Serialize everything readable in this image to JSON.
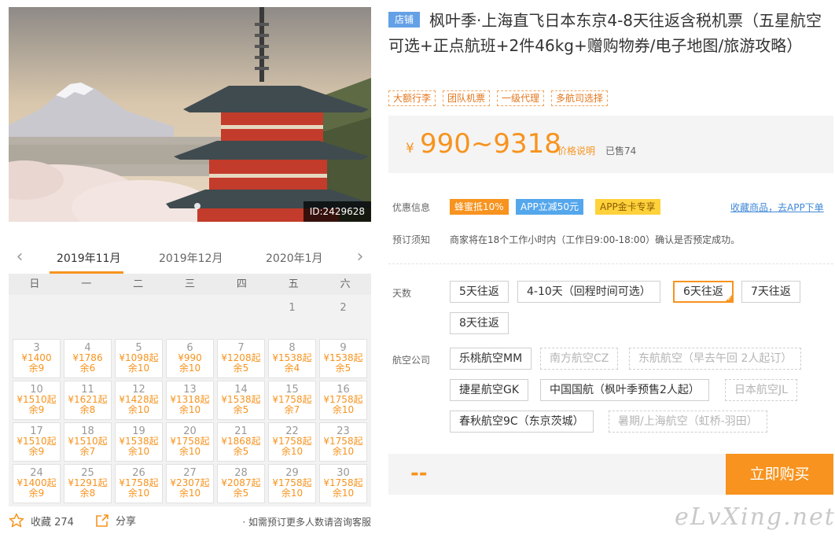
{
  "hero": {
    "id_label": "ID:2429628"
  },
  "calendar": {
    "months": [
      "2019年11月",
      "2019年12月",
      "2020年1月"
    ],
    "weekdays": [
      "日",
      "一",
      "二",
      "三",
      "四",
      "五",
      "六"
    ],
    "empty_days": [
      "1",
      "2"
    ],
    "days": [
      {
        "d": "3",
        "p": "¥1400",
        "r": "余9"
      },
      {
        "d": "4",
        "p": "¥1786",
        "r": "余6"
      },
      {
        "d": "5",
        "p": "¥1098起",
        "r": "余10"
      },
      {
        "d": "6",
        "p": "¥990",
        "r": "余10"
      },
      {
        "d": "7",
        "p": "¥1208起",
        "r": "余5"
      },
      {
        "d": "8",
        "p": "¥1538起",
        "r": "余4"
      },
      {
        "d": "9",
        "p": "¥1538起",
        "r": "余5"
      },
      {
        "d": "10",
        "p": "¥1510起",
        "r": "余9"
      },
      {
        "d": "11",
        "p": "¥1621起",
        "r": "余8"
      },
      {
        "d": "12",
        "p": "¥1428起",
        "r": "余10"
      },
      {
        "d": "13",
        "p": "¥1318起",
        "r": "余10"
      },
      {
        "d": "14",
        "p": "¥1538起",
        "r": "余5"
      },
      {
        "d": "15",
        "p": "¥1758起",
        "r": "余7"
      },
      {
        "d": "16",
        "p": "¥1758起",
        "r": "余10"
      },
      {
        "d": "17",
        "p": "¥1510起",
        "r": "余9"
      },
      {
        "d": "18",
        "p": "¥1510起",
        "r": "余7"
      },
      {
        "d": "19",
        "p": "¥1538起",
        "r": "余10"
      },
      {
        "d": "20",
        "p": "¥1758起",
        "r": "余10"
      },
      {
        "d": "21",
        "p": "¥1868起",
        "r": "余5"
      },
      {
        "d": "22",
        "p": "¥1758起",
        "r": "余10"
      },
      {
        "d": "23",
        "p": "¥1758起",
        "r": "余10"
      },
      {
        "d": "24",
        "p": "¥1400起",
        "r": "余9"
      },
      {
        "d": "25",
        "p": "¥1291起",
        "r": "余8"
      },
      {
        "d": "26",
        "p": "¥1758起",
        "r": "余10"
      },
      {
        "d": "27",
        "p": "¥2307起",
        "r": "余10"
      },
      {
        "d": "28",
        "p": "¥2087起",
        "r": "余5"
      },
      {
        "d": "29",
        "p": "¥1758起",
        "r": "余10"
      },
      {
        "d": "30",
        "p": "¥1758起",
        "r": "余10"
      }
    ]
  },
  "actions": {
    "favorite_label": "收藏 274",
    "share_label": "分享",
    "consult_label": "· 如需预订更多人数请咨询客服"
  },
  "product": {
    "shop_badge": "店铺",
    "title": "枫叶季·上海直飞日本东京4-8天往返含税机票（五星航空可选+正点航班+2件46kg+赠购物券/电子地图/旅游攻略）",
    "tags": [
      "大额行李",
      "团队机票",
      "一级代理",
      "多航司选择"
    ],
    "price_symbol": "¥",
    "price_range": "990~9318",
    "price_note": "价格说明",
    "sold": "已售74"
  },
  "promotions": {
    "label": "优惠信息",
    "items": [
      "蜂蜜抵10%",
      "APP立减50元",
      "APP金卡专享"
    ],
    "app_link": "收藏商品，去APP下单"
  },
  "booking_notice": {
    "label": "预订须知",
    "text": "商家将在18个工作小时内（工作日9:00-18:00）确认是否预定成功。"
  },
  "days_option": {
    "label": "天数",
    "options": [
      "5天往返",
      "4-10天（回程时间可选）",
      "6天往返",
      "7天往返",
      "8天往返"
    ],
    "selected": "6天往返"
  },
  "airline_option": {
    "label": "航空公司",
    "options": [
      {
        "name": "乐桃航空MM",
        "disabled": false
      },
      {
        "name": "南方航空CZ",
        "disabled": true
      },
      {
        "name": "东航航空（早去午回 2人起订）",
        "disabled": true
      },
      {
        "name": "捷星航空GK",
        "disabled": false
      },
      {
        "name": "中国国航（枫叶季预售2人起）",
        "disabled": false
      },
      {
        "name": "日本航空JL",
        "disabled": true
      },
      {
        "name": "春秋航空9C（东京茨城）",
        "disabled": false
      },
      {
        "name": "暑期/上海航空（虹桥-羽田）",
        "disabled": true
      }
    ]
  },
  "buy": {
    "price_placeholder": "--",
    "button_label": "立即购买"
  },
  "watermark": "eLvXing.net",
  "colors": {
    "accent": "#f7931e",
    "link": "#3f88d6",
    "badge": "#64a0e6"
  }
}
